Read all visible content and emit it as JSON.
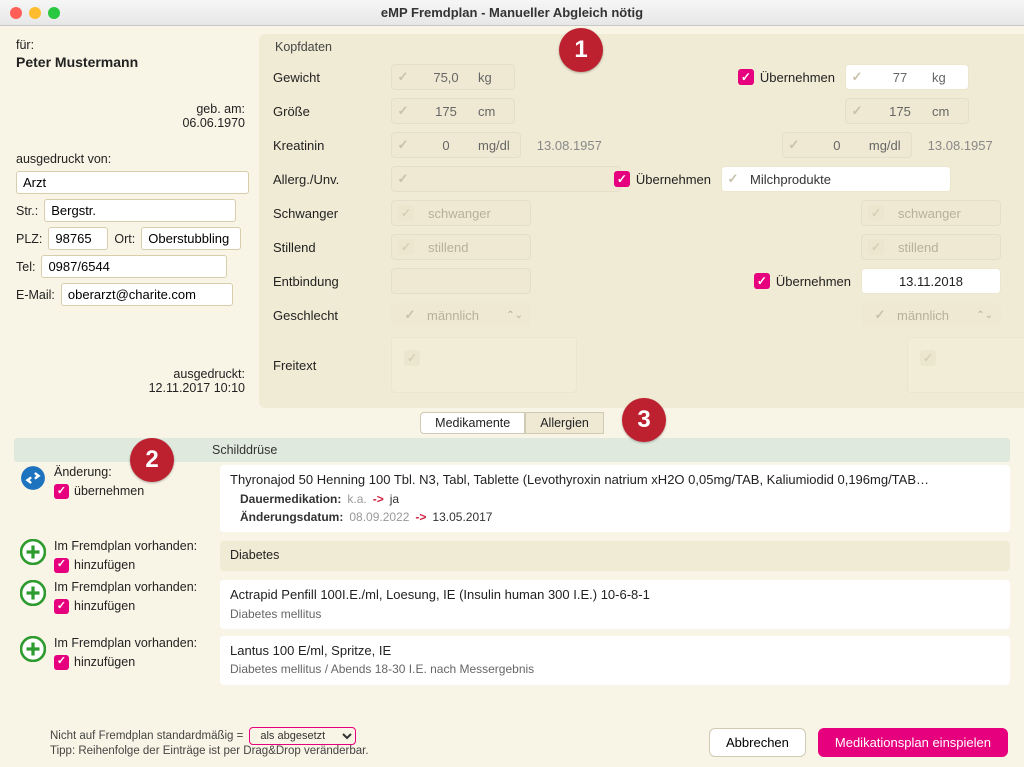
{
  "title": "eMP Fremdplan - Manueller Abgleich nötig",
  "patient": {
    "for_label": "für:",
    "name": "Peter Mustermann",
    "born_label": "geb. am:",
    "born": "06.06.1970"
  },
  "printed_by": {
    "label": "ausgedruckt von:",
    "name": "Arzt",
    "street_label": "Str.:",
    "street": "Bergstr.",
    "plz_label": "PLZ:",
    "plz": "98765",
    "ort_label": "Ort:",
    "ort": "Oberstubbling",
    "tel_label": "Tel:",
    "tel": "0987/6544",
    "email_label": "E-Mail:",
    "email": "oberarzt@charite.com",
    "printed_label": "ausgedruckt:",
    "printed_at": "12.11.2017 10:10"
  },
  "kopfdaten": {
    "section": "Kopfdaten",
    "ubn": "Übernehmen",
    "rows": {
      "gewicht": {
        "label": "Gewicht",
        "left_val": "75,0",
        "left_unit": "kg",
        "right_val": "77",
        "right_unit": "kg"
      },
      "groesse": {
        "label": "Größe",
        "left_val": "175",
        "left_unit": "cm",
        "right_val": "175",
        "right_unit": "cm"
      },
      "kreatinin": {
        "label": "Kreatinin",
        "left_val": "0",
        "left_unit": "mg/dl",
        "left_date": "13.08.1957",
        "right_val": "0",
        "right_unit": "mg/dl",
        "right_date": "13.08.1957"
      },
      "allerg": {
        "label": "Allerg./Unv.",
        "right_val": "Milchprodukte"
      },
      "schwanger": {
        "label": "Schwanger",
        "ph": "schwanger"
      },
      "stillend": {
        "label": "Stillend",
        "ph": "stillend"
      },
      "entbindung": {
        "label": "Entbindung",
        "right_val": "13.11.2018"
      },
      "geschlecht": {
        "label": "Geschlecht",
        "ph": "männlich"
      },
      "freitext": {
        "label": "Freitext"
      }
    }
  },
  "tabs": {
    "med": "Medikamente",
    "all": "Allergien"
  },
  "callouts": {
    "c1": "1",
    "c2": "2",
    "c3": "3"
  },
  "groups": {
    "g1": "Schilddrüse",
    "g2": "Diabetes"
  },
  "status": {
    "aenderung": "Änderung:",
    "uebernehmen": "übernehmen",
    "fremdplan": "Im Fremdplan vorhanden:",
    "hinzufuegen": "hinzufügen"
  },
  "med1": {
    "title": "Thyronajod 50 Henning 100 Tbl. N3, Tabl, Tablette (Levothyroxin natrium xH2O 0,05mg/TAB, Kaliumiodid 0,196mg/TAB…",
    "r1_label": "Dauermedikation:",
    "r1_old": "k.a.",
    "r1_new": "ja",
    "r2_label": "Änderungsdatum:",
    "r2_old": "08.09.2022",
    "r2_new": "13.05.2017"
  },
  "med2": {
    "title": "Actrapid Penfill 100I.E./ml, Loesung, IE (Insulin human 300 I.E.) 10-6-8-1",
    "sub": "Diabetes mellitus"
  },
  "med3": {
    "title": "Lantus 100 E/ml, Spritze, IE",
    "sub": "Diabetes mellitus / Abends 18-30 I.E. nach Messergebnis"
  },
  "footer": {
    "line1": "Nicht auf Fremdplan standardmäßig =",
    "combo": "als abgesetzt",
    "line2": "Tipp: Reihenfolge der Einträge ist per Drag&Drop veränderbar.",
    "cancel": "Abbrechen",
    "primary": "Medikationsplan einspielen"
  }
}
